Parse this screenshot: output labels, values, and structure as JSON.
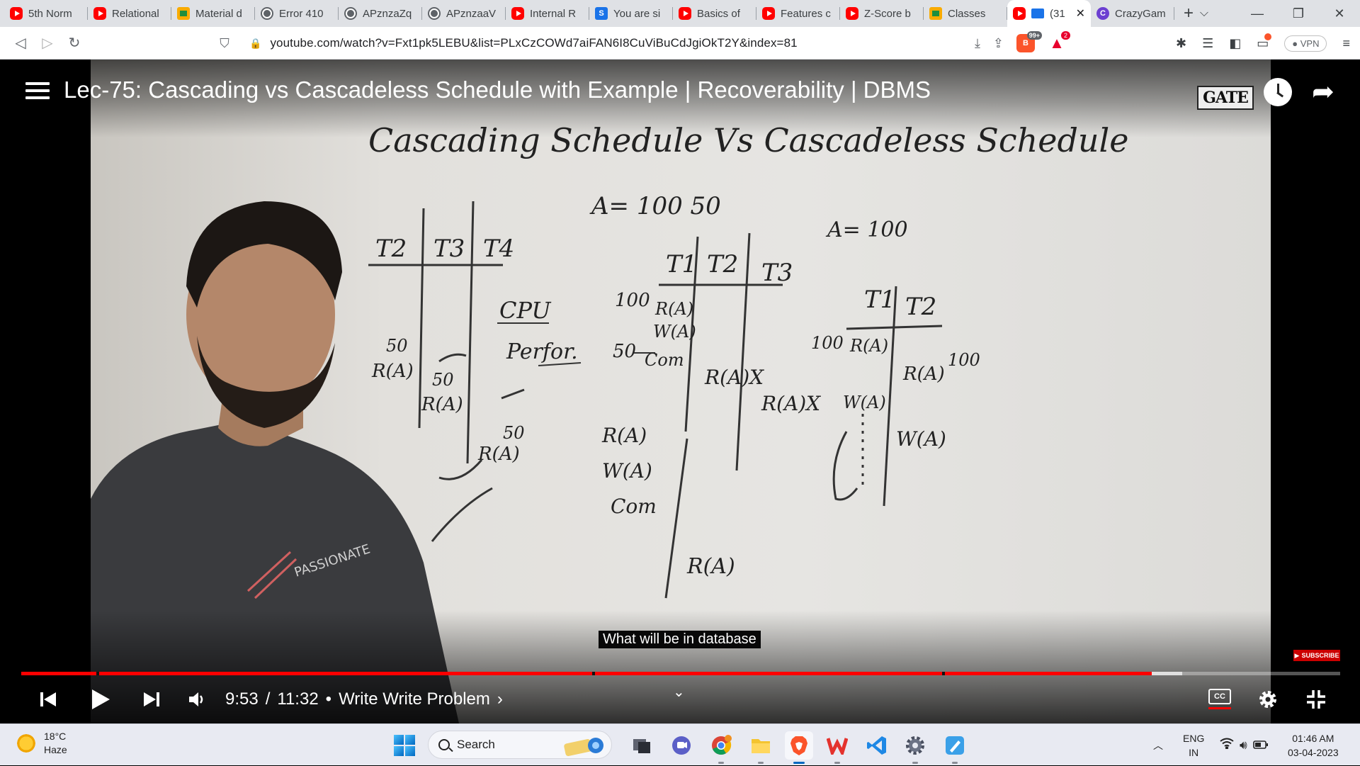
{
  "browser": {
    "tabs": [
      {
        "title": "5th Norm",
        "favicon": "youtube-icon"
      },
      {
        "title": "Relational",
        "favicon": "youtube-icon"
      },
      {
        "title": "Material d",
        "favicon": "classroom-icon"
      },
      {
        "title": "Error 410",
        "favicon": "globe-icon"
      },
      {
        "title": "APznzaZq",
        "favicon": "globe-icon"
      },
      {
        "title": "APznzaaV",
        "favicon": "globe-icon"
      },
      {
        "title": "Internal R",
        "favicon": "youtube-icon"
      },
      {
        "title": "You are si",
        "favicon": "s-icon"
      },
      {
        "title": "Basics of",
        "favicon": "youtube-icon"
      },
      {
        "title": "Features c",
        "favicon": "youtube-icon"
      },
      {
        "title": "Z-Score b",
        "favicon": "youtube-icon"
      },
      {
        "title": "Classes",
        "favicon": "classroom-icon"
      },
      {
        "title": "(31",
        "favicon": "youtube-icon",
        "active": true
      },
      {
        "title": "CrazyGam",
        "favicon": "crazygames-icon"
      }
    ],
    "url": "youtube.com/watch?v=Fxt1pk5LEBU&list=PLxCzCOWd7aiFAN6I8CuViBuCdJgiOkT2Y&index=81",
    "shields_badge": "99+",
    "rewards_badge": "2",
    "vpn_label": "VPN"
  },
  "video": {
    "title": "Lec-75: Cascading vs Cascadeless Schedule with Example | Recoverability | DBMS",
    "caption": "What will be in database",
    "current_time": "9:53",
    "duration": "11:32",
    "time_separator": "/",
    "chapter": "Write Write Problem",
    "chapter_separator": "•",
    "chapter_arrow": "›",
    "progress_fraction": 0.857,
    "buffer_fraction": 0.88,
    "chapter_marks": [
      0.057,
      0.433,
      0.698
    ],
    "subscribe_label": "SUBSCRIBE",
    "cc_label": "CC",
    "channel_logo_text": "GATE",
    "whiteboard": {
      "heading": "Cascading Schedule   Vs   Cascadeless Schedule",
      "a_value_left": "A= 100 50",
      "a_value_right": "A= 100",
      "left_cols": [
        "T2",
        "T3",
        "T4"
      ],
      "mid_cols": [
        "T1",
        "T2",
        "T3"
      ],
      "right_cols": [
        "T1",
        "T2"
      ],
      "cpu": "CPU",
      "perfor": "Perfor."
    }
  },
  "taskbar": {
    "weather_temp": "18°C",
    "weather_desc": "Haze",
    "search_label": "Search",
    "lang_top": "ENG",
    "lang_bottom": "IN",
    "clock_time": "01:46 AM",
    "clock_date": "03-04-2023"
  }
}
